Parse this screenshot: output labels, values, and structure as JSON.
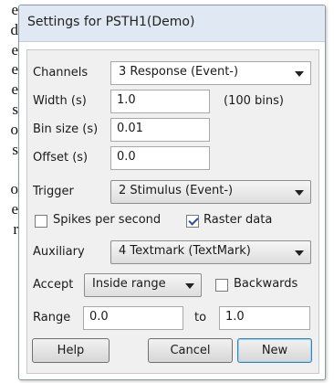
{
  "background_text": [
    "e",
    "d",
    "e",
    "e",
    "e",
    "s",
    "o",
    "s",
    "",
    "o",
    "e",
    "r"
  ],
  "dialog": {
    "title": "Settings for PSTH1(Demo)",
    "channels_label": "Channels",
    "channels_value": "3 Response (Event-)",
    "width_label": "Width (s)",
    "width_value": "1.0",
    "width_bins": "(100 bins)",
    "binsize_label": "Bin size (s)",
    "binsize_value": "0.01",
    "offset_label": "Offset (s)",
    "offset_value": "0.0",
    "trigger_label": "Trigger",
    "trigger_value": "2 Stimulus (Event-)",
    "spikes_label": "Spikes per second",
    "spikes_checked": false,
    "raster_label": "Raster data",
    "raster_checked": true,
    "auxiliary_label": "Auxiliary",
    "auxiliary_value": "4 Textmark (TextMark)",
    "accept_label": "Accept",
    "accept_value": "Inside range",
    "backwards_label": "Backwards",
    "backwards_checked": false,
    "range_label": "Range",
    "range_from": "0.0",
    "range_to_label": "to",
    "range_to": "1.0",
    "help_button": "Help",
    "cancel_button": "Cancel",
    "new_button": "New"
  }
}
